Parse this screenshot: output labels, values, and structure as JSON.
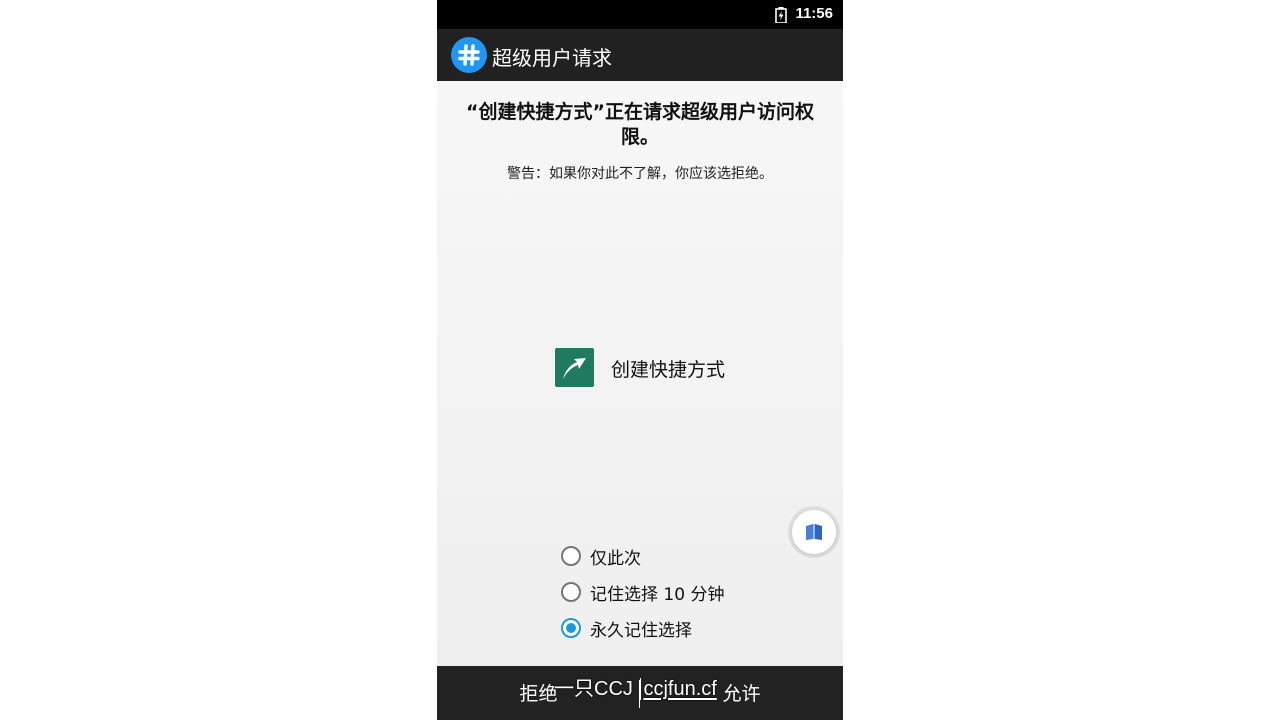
{
  "status_bar": {
    "time": "11:56",
    "battery_icon": "battery-charging-icon"
  },
  "app_bar": {
    "logo_icon": "hash-icon",
    "title": "超级用户请求",
    "color": "#212121",
    "logo_color": "#2196f3"
  },
  "request": {
    "title": "“创建快捷方式”正在请求超级用户访问权限。",
    "warning": "警告：如果你对此不了解，你应该选拒绝。"
  },
  "requesting_app": {
    "icon": "share-arrow-icon",
    "name": "创建快捷方式",
    "icon_color": "#1f7a60"
  },
  "floating_button": {
    "icon": "book-icon"
  },
  "options": [
    {
      "label": "仅此次",
      "checked": false
    },
    {
      "label": "记住选择 10 分钟",
      "checked": false
    },
    {
      "label": "永久记住选择",
      "checked": true
    }
  ],
  "accent_color": "#1e9ad6",
  "bottom_bar": {
    "deny_label": "拒绝",
    "allow_label": "允许"
  },
  "watermark": {
    "name": "一只CCJ",
    "url": "ccjfun.cf"
  }
}
